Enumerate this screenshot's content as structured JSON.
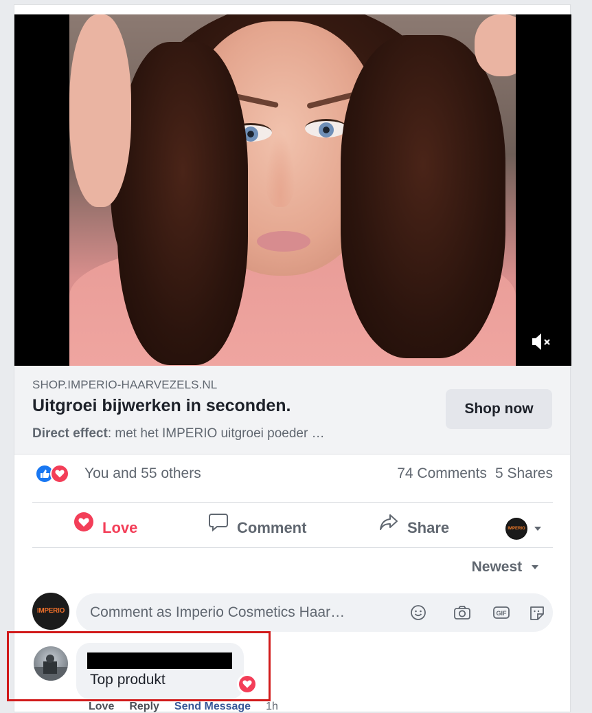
{
  "post": {
    "link": {
      "domain": "SHOP.IMPERIO-HAARVEZELS.NL",
      "headline": "Uitgroei bijwerken in seconden.",
      "desc_bold": "Direct effect",
      "desc_rest": ": met het IMPERIO uitgroei poeder …",
      "cta": "Shop now"
    },
    "reactions": {
      "summary": "You and 55 others",
      "comments": "74 Comments",
      "shares": "5 Shares",
      "icons": [
        "like-icon",
        "love-icon"
      ]
    },
    "actions": {
      "love": "Love",
      "comment": "Comment",
      "share": "Share"
    },
    "page_avatar_text": "IMPERIO",
    "sort_label": "Newest",
    "composer": {
      "placeholder": "Comment as Imperio Cosmetics Haar…",
      "avatar_text": "IMPERIO",
      "icons": [
        "emoji-icon",
        "camera-icon",
        "gif-icon",
        "sticker-icon"
      ]
    },
    "comment": {
      "author": "",
      "text": "Top produkt",
      "meta": {
        "love": "Love",
        "reply": "Reply",
        "send": "Send Message",
        "time": "1h"
      }
    }
  },
  "colors": {
    "love": "#f33e58",
    "like": "#1877f2",
    "highlight_border": "#d11a1a",
    "link_preview_bg": "#f2f3f5"
  }
}
